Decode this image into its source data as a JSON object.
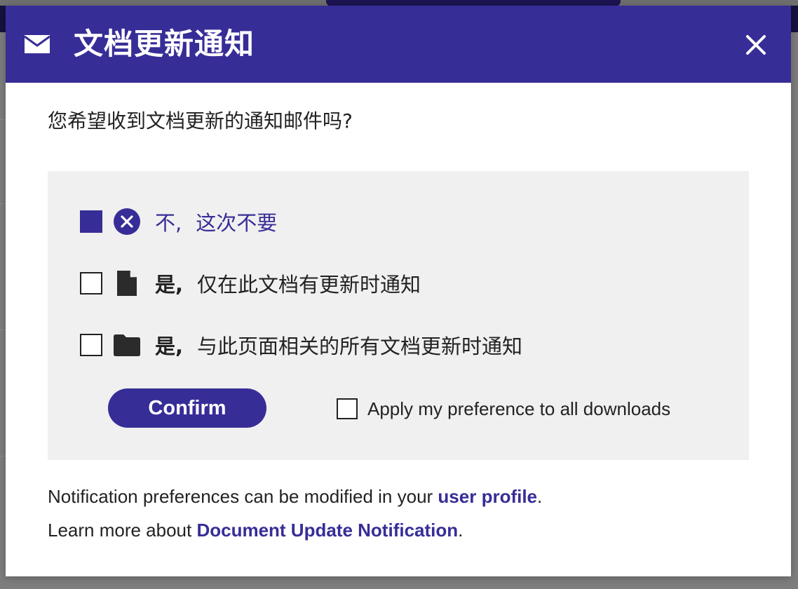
{
  "modal": {
    "title": "文档更新通知",
    "question": "您希望收到文档更新的通知邮件吗?",
    "options": [
      {
        "lead": "不,",
        "rest": "这次不要",
        "icon": "cancel-circle-icon",
        "checked": true
      },
      {
        "lead": "是,",
        "rest": "仅在此文档有更新时通知",
        "icon": "document-icon",
        "checked": false
      },
      {
        "lead": "是,",
        "rest": "与此页面相关的所有文档更新时通知",
        "icon": "folder-icon",
        "checked": false
      }
    ],
    "confirm_label": "Confirm",
    "apply_all_label": "Apply my preference to all downloads",
    "footer": {
      "line1_prefix": "Notification preferences can be modified in your ",
      "line1_link": "user profile",
      "line1_suffix": ".",
      "line2_prefix": "Learn more about ",
      "line2_link": "Document Update Notification",
      "line2_suffix": "."
    }
  },
  "colors": {
    "brand": "#372d97",
    "panel_bg": "#f0f0f0",
    "text": "#222222"
  }
}
